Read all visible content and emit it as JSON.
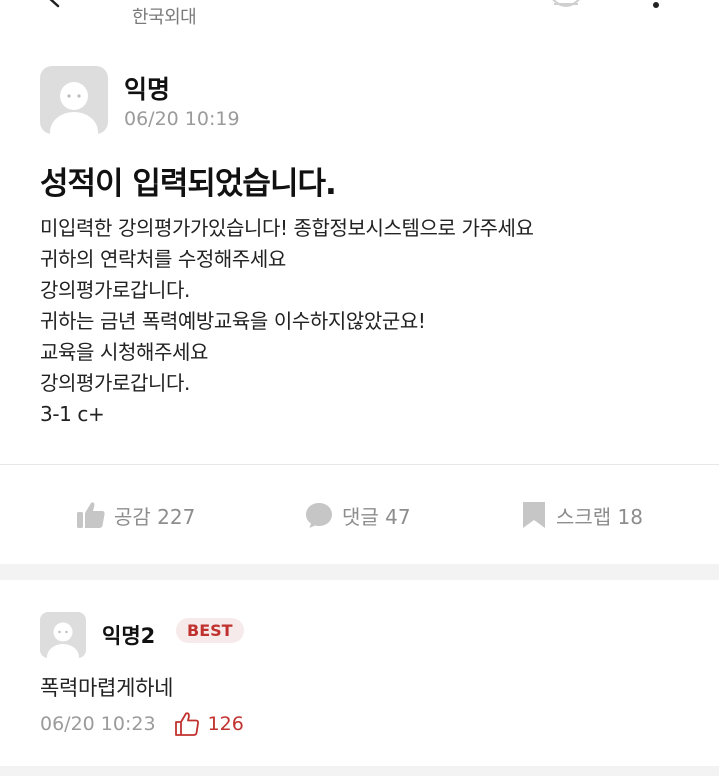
{
  "header": {
    "board_name": "한국외대"
  },
  "post": {
    "author": "익명",
    "date": "06/20 10:19",
    "title": "성적이 입력되었습니다.",
    "body_lines": [
      "미입력한 강의평가가있습니다! 종합정보시스템으로 가주세요",
      "귀하의 연락처를 수정해주세요",
      "강의평가로갑니다.",
      "귀하는 금년 폭력예방교육을 이수하지않았군요!",
      "교육을 시청해주세요",
      "강의평가로갑니다.",
      "3-1 c+"
    ],
    "actions": {
      "like": "공감 227",
      "comment": "댓글 47",
      "scrap": "스크랩 18"
    }
  },
  "comments": [
    {
      "author": "익명2",
      "badge": "BEST",
      "text": "폭력마렵게하네",
      "date": "06/20 10:23",
      "likes": "126"
    }
  ],
  "colors": {
    "accent": "#c0322f",
    "muted_text": "#9b9b9b",
    "icon_gray": "#c6c6c6",
    "avatar_bg": "#dddddd",
    "section_gap": "#f3f3f3"
  },
  "icons": [
    "back-arrow-icon",
    "top-right-icon",
    "more-dots-icon",
    "default-avatar-icon",
    "thumbs-up-icon",
    "speech-bubble-icon",
    "bookmark-icon"
  ]
}
